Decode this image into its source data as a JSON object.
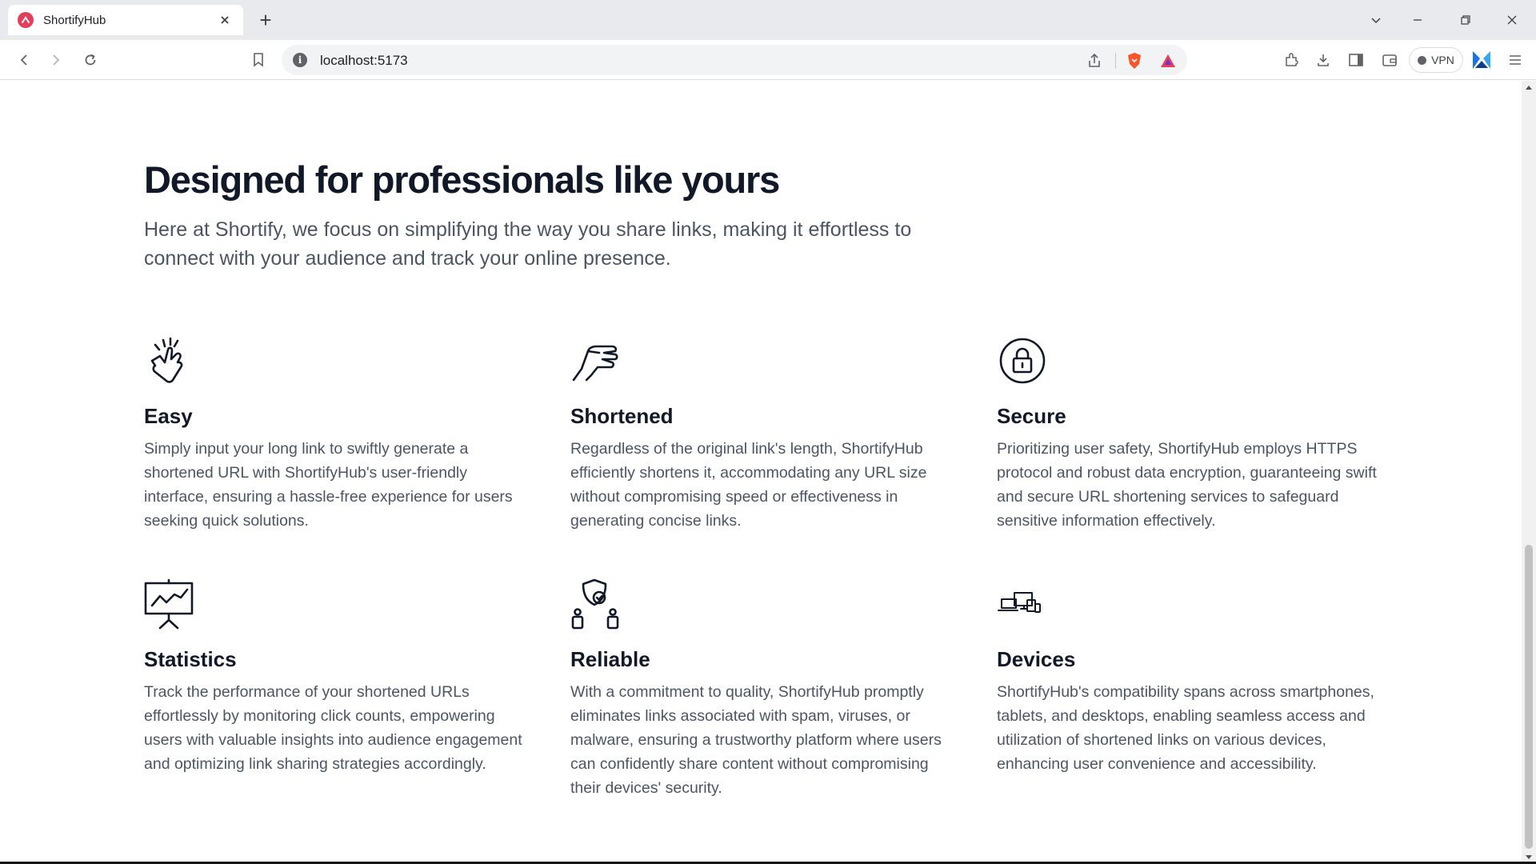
{
  "browser": {
    "tab_title": "ShortifyHub",
    "url": "localhost:5173",
    "vpn_label": "VPN",
    "brand_color": "#e53e5b"
  },
  "section": {
    "headline": "Designed for professionals like yours",
    "lede": "Here at Shortify, we focus on simplifying the way you share links, making it effortless to connect with your audience and track your online presence."
  },
  "features": [
    {
      "icon": "snap-fingers-icon",
      "title": "Easy",
      "text": "Simply input your long link to swiftly generate a shortened URL with ShortifyHub's user-friendly interface, ensuring a hassle-free experience for users seeking quick solutions."
    },
    {
      "icon": "pinch-hand-icon",
      "title": "Shortened",
      "text": "Regardless of the original link's length, ShortifyHub efficiently shortens it, accommodating any URL size without compromising speed or effectiveness in generating concise links."
    },
    {
      "icon": "lock-circle-icon",
      "title": "Secure",
      "text": "Prioritizing user safety, ShortifyHub employs HTTPS protocol and robust data encryption, guaranteeing swift and secure URL shortening services to safeguard sensitive information effectively."
    },
    {
      "icon": "presentation-chart-icon",
      "title": "Statistics",
      "text": "Track the performance of your shortened URLs effortlessly by monitoring click counts, empowering users with valuable insights into audience engagement and optimizing link sharing strategies accordingly."
    },
    {
      "icon": "shield-users-icon",
      "title": "Reliable",
      "text": "With a commitment to quality, ShortifyHub promptly eliminates links associated with spam, viruses, or malware, ensuring a trustworthy platform where users can confidently share content without compromising their devices' security."
    },
    {
      "icon": "devices-icon",
      "title": "Devices",
      "text": "ShortifyHub's compatibility spans across smartphones, tablets, and desktops, enabling seamless access and utilization of shortened links on various devices, enhancing user convenience and accessibility."
    }
  ]
}
